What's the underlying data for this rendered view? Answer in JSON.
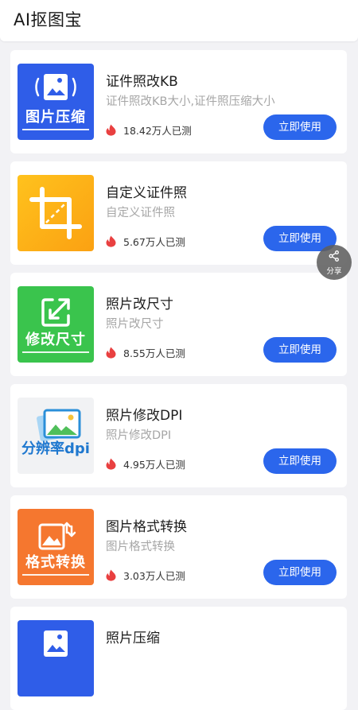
{
  "app": {
    "title": "AI抠图宝",
    "share_label": "分享"
  },
  "colors": {
    "button": "#2b66ec",
    "flame": "#e94040",
    "page_bg": "#f2f2f5"
  },
  "tools": [
    {
      "name": "证件照改KB",
      "desc": "证件照改KB大小,证件照压缩大小",
      "count": "18.42万人已测",
      "button": "立即使用",
      "thumb_caption": "图片压缩",
      "thumb_icon": "compress-photo-icon",
      "thumb_color": "#2f5de8"
    },
    {
      "name": "自定义证件照",
      "desc": "自定义证件照",
      "count": "5.67万人已测",
      "button": "立即使用",
      "thumb_caption": "",
      "thumb_icon": "crop-icon",
      "thumb_color": "#fcae14"
    },
    {
      "name": "照片改尺寸",
      "desc": "照片改尺寸",
      "count": "8.55万人已测",
      "button": "立即使用",
      "thumb_caption": "修改尺寸",
      "thumb_icon": "resize-icon",
      "thumb_color": "#3ac44d"
    },
    {
      "name": "照片修改DPI",
      "desc": "照片修改DPI",
      "count": "4.95万人已测",
      "button": "立即使用",
      "thumb_caption": "分辨率dpi",
      "thumb_icon": "resolution-photo-icon",
      "thumb_color": "#f1f2f4"
    },
    {
      "name": "图片格式转换",
      "desc": "图片格式转换",
      "count": "3.03万人已测",
      "button": "立即使用",
      "thumb_caption": "格式转换",
      "thumb_icon": "format-convert-icon",
      "thumb_color": "#f5772f"
    },
    {
      "name": "照片压缩",
      "desc": "",
      "count": "",
      "button": "",
      "thumb_caption": "",
      "thumb_icon": "compress-photo-icon",
      "thumb_color": "#2f5de8"
    }
  ]
}
